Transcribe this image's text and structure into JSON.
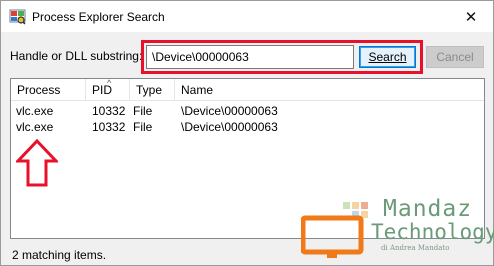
{
  "window": {
    "title": "Process Explorer Search",
    "close_glyph": "✕",
    "icon": "process-explorer-icon"
  },
  "search": {
    "label": "Handle or DLL substring:",
    "value": "\\Device\\00000063",
    "search_button": "Search",
    "cancel_button": "Cancel"
  },
  "list": {
    "columns": [
      "Process",
      "PID",
      "Type",
      "Name"
    ],
    "sorted_column": "PID",
    "rows": [
      {
        "process": "vlc.exe",
        "pid": "10332",
        "type": "File",
        "name": "\\Device\\00000063"
      },
      {
        "process": "vlc.exe",
        "pid": "10332",
        "type": "File",
        "name": "\\Device\\00000063"
      }
    ]
  },
  "annotation": {
    "arrow_color": "#e8102a",
    "highlight_color": "#e8102a"
  },
  "watermark": {
    "line1": "Mandaz",
    "line2": "Technology",
    "credit": "di Andrea Mandato",
    "color": "#6a9a78"
  },
  "status": {
    "text": "2 matching items."
  }
}
